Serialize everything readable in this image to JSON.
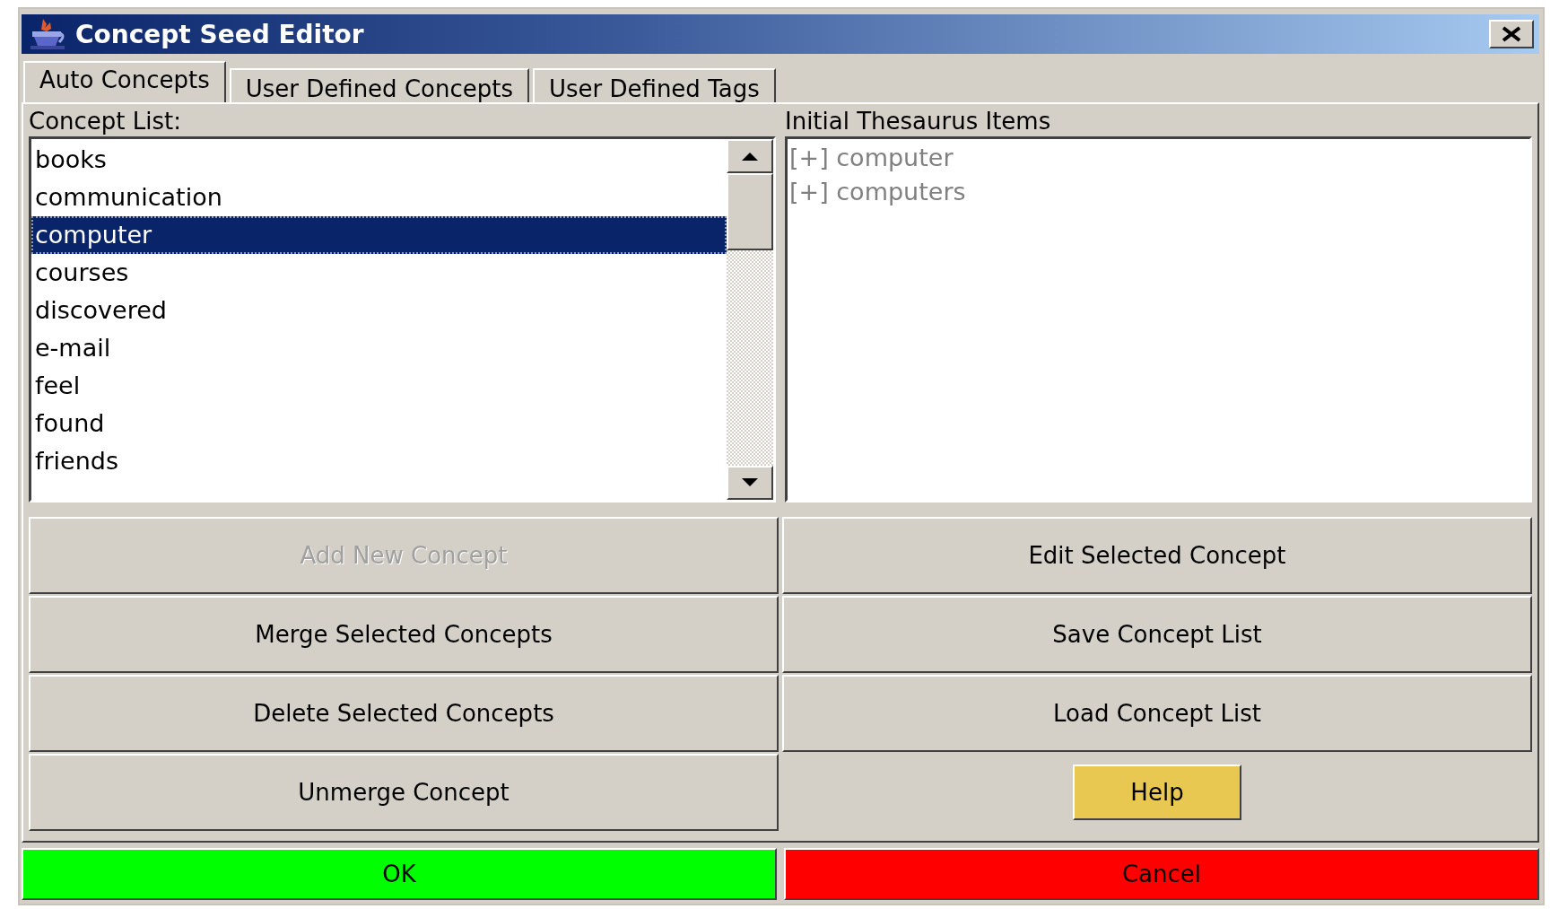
{
  "window": {
    "title": "Concept Seed Editor"
  },
  "tabs": [
    {
      "label": "Auto Concepts",
      "selected": true
    },
    {
      "label": "User Defined Concepts",
      "selected": false
    },
    {
      "label": "User Defined Tags",
      "selected": false
    }
  ],
  "concept_list": {
    "label": "Concept List:",
    "items": [
      {
        "text": "books",
        "selected": false
      },
      {
        "text": "communication",
        "selected": false
      },
      {
        "text": "computer",
        "selected": true
      },
      {
        "text": "courses",
        "selected": false
      },
      {
        "text": "discovered",
        "selected": false
      },
      {
        "text": "e-mail",
        "selected": false
      },
      {
        "text": "feel",
        "selected": false
      },
      {
        "text": "found",
        "selected": false
      },
      {
        "text": "friends",
        "selected": false
      }
    ]
  },
  "thesaurus": {
    "label": "Initial Thesaurus Items",
    "items": [
      {
        "text": "[+] computer",
        "disabled": true
      },
      {
        "text": "[+] computers",
        "disabled": true
      }
    ]
  },
  "action_buttons": [
    {
      "label": "Add New Concept",
      "disabled": true
    },
    {
      "label": "Edit Selected Concept",
      "disabled": false
    },
    {
      "label": "Merge Selected Concepts",
      "disabled": false
    },
    {
      "label": "Save Concept List",
      "disabled": false
    },
    {
      "label": "Delete Selected Concepts",
      "disabled": false
    },
    {
      "label": "Load Concept List",
      "disabled": false
    },
    {
      "label": "Unmerge Concept",
      "disabled": false
    }
  ],
  "help_button": {
    "label": "Help"
  },
  "dialog_buttons": [
    {
      "label": "OK",
      "color": "#00ff00"
    },
    {
      "label": "Cancel",
      "color": "#ff0000"
    }
  ]
}
